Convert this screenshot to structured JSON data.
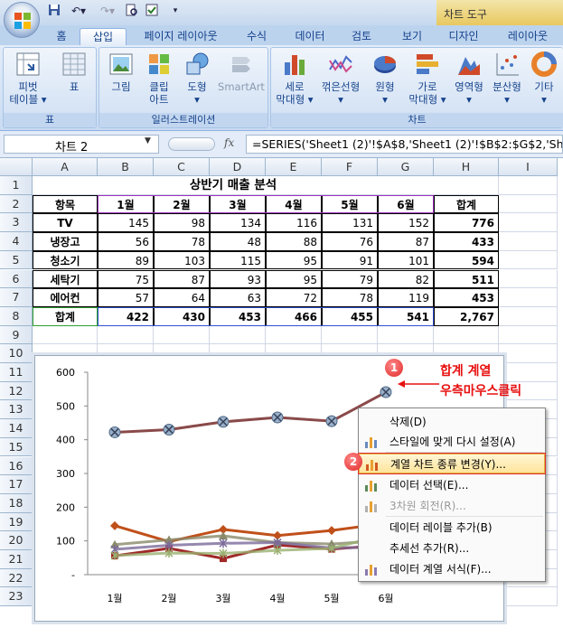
{
  "quick_access": [
    "save-icon",
    "undo-icon",
    "redo-icon",
    "print-preview-icon",
    "check-icon"
  ],
  "chart_tools_label": "차트 도구",
  "tabs": [
    {
      "label": "홈"
    },
    {
      "label": "삽입",
      "active": true
    },
    {
      "label": "페이지 레이아웃"
    },
    {
      "label": "수식"
    },
    {
      "label": "데이터"
    },
    {
      "label": "검토"
    },
    {
      "label": "보기"
    },
    {
      "label": "디자인"
    },
    {
      "label": "레이아웃"
    }
  ],
  "ribbon": {
    "groups": [
      {
        "label": "표",
        "buttons": [
          {
            "line1": "피벗",
            "line2": "테이블 ▾",
            "icon": "pivot-table-icon"
          },
          {
            "line1": "표",
            "line2": "",
            "icon": "table-icon"
          }
        ]
      },
      {
        "label": "일러스트레이션",
        "buttons": [
          {
            "line1": "그림",
            "line2": "",
            "icon": "picture-icon"
          },
          {
            "line1": "클립",
            "line2": "아트",
            "icon": "clipart-icon"
          },
          {
            "line1": "도형",
            "line2": "▾",
            "icon": "shapes-icon"
          },
          {
            "line1": "SmartArt",
            "line2": "",
            "icon": "smartart-icon"
          }
        ]
      },
      {
        "label": "차트",
        "buttons": [
          {
            "line1": "세로",
            "line2": "막대형 ▾",
            "icon": "column-chart-icon"
          },
          {
            "line1": "꺾은선형",
            "line2": "▾",
            "icon": "line-chart-icon"
          },
          {
            "line1": "원형",
            "line2": "▾",
            "icon": "pie-chart-icon"
          },
          {
            "line1": "가로",
            "line2": "막대형 ▾",
            "icon": "bar-chart-icon"
          },
          {
            "line1": "영역형",
            "line2": "▾",
            "icon": "area-chart-icon"
          },
          {
            "line1": "분산형",
            "line2": "▾",
            "icon": "scatter-chart-icon"
          },
          {
            "line1": "기타",
            "line2": "▾",
            "icon": "other-chart-icon"
          }
        ]
      }
    ]
  },
  "name_box": "차트 2",
  "fx_label": "fx",
  "formula": "=SERIES('Sheet1 (2)'!$A$8,'Sheet1 (2)'!$B$2:$G$2,'Sh",
  "columns": [
    "A",
    "B",
    "C",
    "D",
    "E",
    "F",
    "G",
    "H",
    "I"
  ],
  "rows": [
    "1",
    "2",
    "3",
    "4",
    "5",
    "6",
    "7",
    "8",
    "9",
    "10",
    "11",
    "12",
    "13",
    "14",
    "15",
    "16",
    "17",
    "18",
    "19",
    "20",
    "21",
    "22",
    "23"
  ],
  "sheet": {
    "title": "상반기 매출 분석",
    "header": [
      "항목",
      "1월",
      "2월",
      "3월",
      "4월",
      "5월",
      "6월",
      "합계"
    ],
    "data": [
      [
        "TV",
        "145",
        "98",
        "134",
        "116",
        "131",
        "152",
        "776"
      ],
      [
        "냉장고",
        "56",
        "78",
        "48",
        "88",
        "76",
        "87",
        "433"
      ],
      [
        "청소기",
        "89",
        "103",
        "115",
        "95",
        "91",
        "101",
        "594"
      ],
      [
        "세탁기",
        "75",
        "87",
        "93",
        "95",
        "79",
        "82",
        "511"
      ],
      [
        "에어컨",
        "57",
        "64",
        "63",
        "72",
        "78",
        "119",
        "453"
      ],
      [
        "합계",
        "422",
        "430",
        "453",
        "466",
        "455",
        "541",
        "2,767"
      ]
    ]
  },
  "chart_data": {
    "type": "line",
    "categories": [
      "1월",
      "2월",
      "3월",
      "4월",
      "5월",
      "6월"
    ],
    "ylim": [
      0,
      600
    ],
    "y_ticks": [
      "600",
      "500",
      "400",
      "300",
      "200",
      "100",
      "-"
    ],
    "series": [
      {
        "name": "TV",
        "values": [
          145,
          98,
          134,
          116,
          131,
          152
        ],
        "color": "#c0501a"
      },
      {
        "name": "냉장고",
        "values": [
          56,
          78,
          48,
          88,
          76,
          87
        ],
        "color": "#a02828"
      },
      {
        "name": "청소기",
        "values": [
          89,
          103,
          115,
          95,
          91,
          101
        ],
        "color": "#8a8a6a"
      },
      {
        "name": "세탁기",
        "values": [
          75,
          87,
          93,
          95,
          79,
          82
        ],
        "color": "#7a6a9a"
      },
      {
        "name": "에어컨",
        "values": [
          57,
          64,
          63,
          72,
          78,
          119
        ],
        "color": "#9ab070"
      },
      {
        "name": "합계",
        "values": [
          422,
          430,
          453,
          466,
          455,
          541
        ],
        "color": "#8a4a4a"
      }
    ]
  },
  "context_menu": [
    {
      "label": "삭제(D)",
      "icon": "",
      "disabled": false
    },
    {
      "label": "스타일에 맞게 다시 설정(A)",
      "icon": "reset-style-icon",
      "disabled": false
    },
    {
      "label": "계열 차트 종류 변경(Y)...",
      "icon": "change-chart-type-icon",
      "disabled": false,
      "highlight": true
    },
    {
      "label": "데이터 선택(E)...",
      "icon": "select-data-icon",
      "disabled": false
    },
    {
      "label": "3차원 회전(R)...",
      "icon": "3d-rotation-icon",
      "disabled": true
    },
    {
      "label": "데이터 레이블 추가(B)",
      "icon": "",
      "disabled": false
    },
    {
      "label": "추세선 추가(R)...",
      "icon": "",
      "disabled": false
    },
    {
      "label": "데이터 계열 서식(F)...",
      "icon": "format-series-icon",
      "disabled": false
    }
  ],
  "annotations": {
    "badge1": "1",
    "badge2": "2",
    "callout_line1": "합계 계열",
    "callout_line2": "우측마우스클릭"
  }
}
